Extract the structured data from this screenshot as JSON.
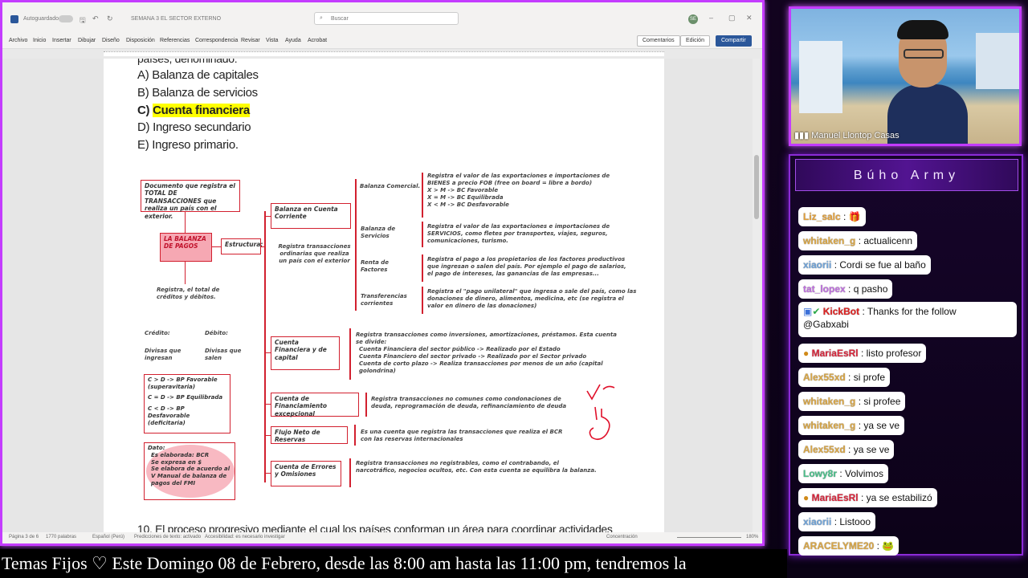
{
  "word": {
    "autosave_label": "Autoguardado",
    "doc_title": "SEMANA 3 EL SECTOR EXTERNO",
    "search_placeholder": "Buscar",
    "user_initials": "SE",
    "menu": [
      "Archivo",
      "Inicio",
      "Insertar",
      "Dibujar",
      "Diseño",
      "Disposición",
      "Referencias",
      "Correspondencia",
      "Revisar",
      "Vista",
      "Ayuda",
      "Acrobat"
    ],
    "comments_label": "Comentarios",
    "editing_label": "Edición",
    "share_label": "Compartir",
    "status": {
      "page": "Página 3 de 6",
      "words": "1770 palabras",
      "language": "Español (Perú)",
      "predictions": "Predicciones de texto: activado",
      "accessibility": "Accesibilidad: es necesario investigar",
      "focus": "Concentración",
      "zoom": "180%"
    }
  },
  "doc": {
    "cut_line": "países, denominado:",
    "options": [
      {
        "letter": "A)",
        "text": "Balanza de capitales"
      },
      {
        "letter": "B)",
        "text": "Balanza de servicios"
      },
      {
        "letter": "C)",
        "text": "Cuenta financiera"
      },
      {
        "letter": "D)",
        "text": "Ingreso secundario"
      },
      {
        "letter": "E)",
        "text": "Ingreso primario."
      }
    ],
    "bottom_line": "10. El proceso progresivo mediante el cual los países conforman un área para coordinar actividades",
    "diagram": {
      "doc_box": "Documento que registra el TOTAL DE TRANSACCIONES que realiza un país con el exterior.",
      "bp_box": "LA BALANZA DE PAGOS",
      "estructura": "Estructura:",
      "registra_total": "Registra, el total de créditos y débitos.",
      "credito": "Crédito:",
      "debito": "Débito:",
      "divisas_ingresan": "Divisas que ingresan",
      "divisas_salen": "Divisas que salen",
      "bp_conditions": [
        "C > D -> BP Favorable (superavitaria)",
        "C = D -> BP Equilibrada",
        "C < D -> BP Desfavorable (deficitaria)"
      ],
      "dato": [
        "Dato:",
        "Es elaborada: BCR",
        "Se expresa en $",
        "Se elabora de acuerdo al V Manual de balanza de pagos del FMI"
      ],
      "cuenta_corriente": "Balanza en Cuenta Corriente",
      "cc_desc": "Registra transacciones ordinarias que realiza un país con el exterior",
      "comercial": "Balanza Comercial.",
      "comercial_desc": [
        "Registra el valor de las exportaciones e importaciones de",
        "BIENES a precio FOB (free on board = libre a bordo)",
        "X > M -> BC Favorable",
        "X = M -> BC Equilibrada",
        "X < M -> BC Desfavorable"
      ],
      "servicios": "Balanza de Servicios",
      "servicios_desc": "Registra el valor de las exportaciones e importaciones de SERVICIOS, como fletes por transportes, viajes, seguros, comunicaciones, turismo.",
      "renta": "Renta de Factores",
      "renta_desc": "Registra el pago a los propietarios de los factores productivos que ingresan o salen del país. Por ejemplo el pago de salarios, el pago de intereses, las ganancias de las empresas...",
      "transferencias": "Transferencias corrientes",
      "transferencias_desc": "Registra el \"pago unilateral\" que ingresa o sale del país, como las donaciones de dinero, alimentos, medicina, etc (se registra el valor en dinero de las donaciones)",
      "financiera": "Cuenta Financiera y de capital",
      "financiera_desc": [
        "Registra transacciones como inversiones, amortizaciones, préstamos. Esta cuenta se divide:",
        "Cuenta Financiera del sector público -> Realizado por el Estado",
        "Cuenta Financiero del sector privado -> Realizado por el Sector privado",
        "Cuenta de corto plazo -> Realiza transacciones por menos de un año (capital golondrina)"
      ],
      "financiamiento": "Cuenta de Financiamiento excepcional",
      "financiamiento_desc": "Registra transacciones no comunes como condonaciones de deuda, reprogramación de deuda, refinanciamiento de deuda",
      "reservas": "Flujo Neto de Reservas",
      "reservas_desc": "Es una cuenta que registra las transacciones que realiza el BCR con las reservas internacionales",
      "errores": "Cuenta de Errores y Omisiones",
      "errores_desc": "Registra transacciones no registrables, como el contrabando, el narcotráfico, negocios ocultos, etc. Con esta cuenta se equilibra la balanza."
    }
  },
  "webcam": {
    "name": "Manuel Llontop Casas"
  },
  "chat": {
    "title": "Búho Army",
    "messages": [
      {
        "user": "Liz_salc",
        "text": ":",
        "emote": "gift",
        "color": "#e3a03a"
      },
      {
        "user": "whitaken_g",
        "text": ": actualicenn",
        "color": "#d9a645"
      },
      {
        "user": "xiaorii",
        "text": ": Cordi se fue al baño",
        "color": "#6fa3d8"
      },
      {
        "user": "tat_lopex",
        "text": ": q pasho",
        "color": "#c070e0"
      },
      {
        "user": "KickBot",
        "text": ": Thanks for the follow",
        "text2": "@Gabxabi",
        "color": "#e02020"
      },
      {
        "user": "MariaEsRl",
        "text": ": listo profesor",
        "color": "#d9263c"
      },
      {
        "user": "Alex55xd",
        "text": ": si profe",
        "color": "#d9a645"
      },
      {
        "user": "whitaken_g",
        "text": ": si profee",
        "color": "#d9a645"
      },
      {
        "user": "whitaken_g",
        "text": ": ya se ve",
        "color": "#d9a645"
      },
      {
        "user": "Alex55xd",
        "text": ": ya se ve",
        "color": "#d9a645"
      },
      {
        "user": "Lowy8r",
        "text": ": Volvimos",
        "color": "#4ac08a"
      },
      {
        "user": "MariaEsRl",
        "text": ": ya se estabilizó",
        "color": "#d9263c"
      },
      {
        "user": "xiaorii",
        "text": ": Listooo",
        "color": "#6fa3d8"
      },
      {
        "user": "ARACELYME20",
        "text": ":",
        "emote": "frog",
        "color": "#d9a645"
      }
    ]
  },
  "ticker": "Temas Fijos ♡  Este Domingo 08 de Febrero, desde las 8:00 am hasta las 11:00 pm, tendremos la"
}
